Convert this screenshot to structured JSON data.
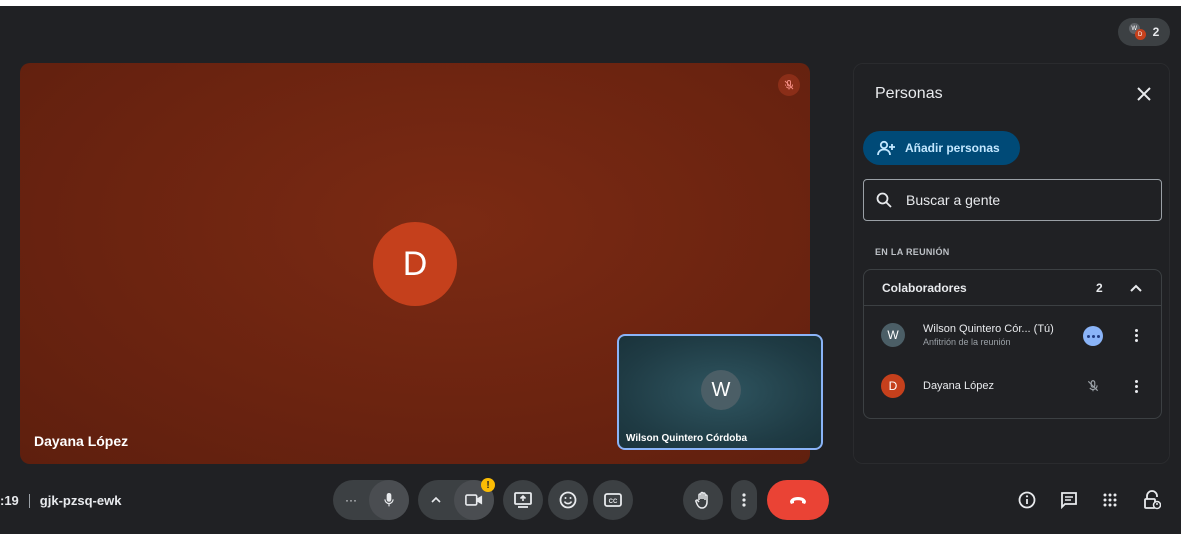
{
  "top_chip": {
    "count": "2",
    "avatars": [
      "W",
      "D"
    ]
  },
  "main_tile": {
    "avatar_letter": "D",
    "name": "Dayana López",
    "avatar_color": "#c5401c"
  },
  "self_tile": {
    "avatar_letter": "W",
    "name": "Wilson Quintero Córdoba"
  },
  "panel": {
    "title": "Personas",
    "add_button": "Añadir personas",
    "search_placeholder": "Buscar a gente",
    "section_label": "EN LA REUNIÓN",
    "group": {
      "title": "Colaboradores",
      "count": "2",
      "people": [
        {
          "letter": "W",
          "name": "Wilson Quintero Cór... (Tú)",
          "subtitle": "Anfitrión de la reunión",
          "avatar_color": "#4b5e66"
        },
        {
          "letter": "D",
          "name": "Dayana López",
          "subtitle": "",
          "avatar_color": "#c5401c"
        }
      ]
    }
  },
  "bottom_bar": {
    "time": ":19",
    "meeting_code": "gjk-pzsq-ewk",
    "more_label": "···",
    "warning_badge": "!"
  },
  "colors": {
    "accent": "#8ab4f8",
    "hangup": "#ea4335",
    "add_button_bg": "#004a77"
  }
}
